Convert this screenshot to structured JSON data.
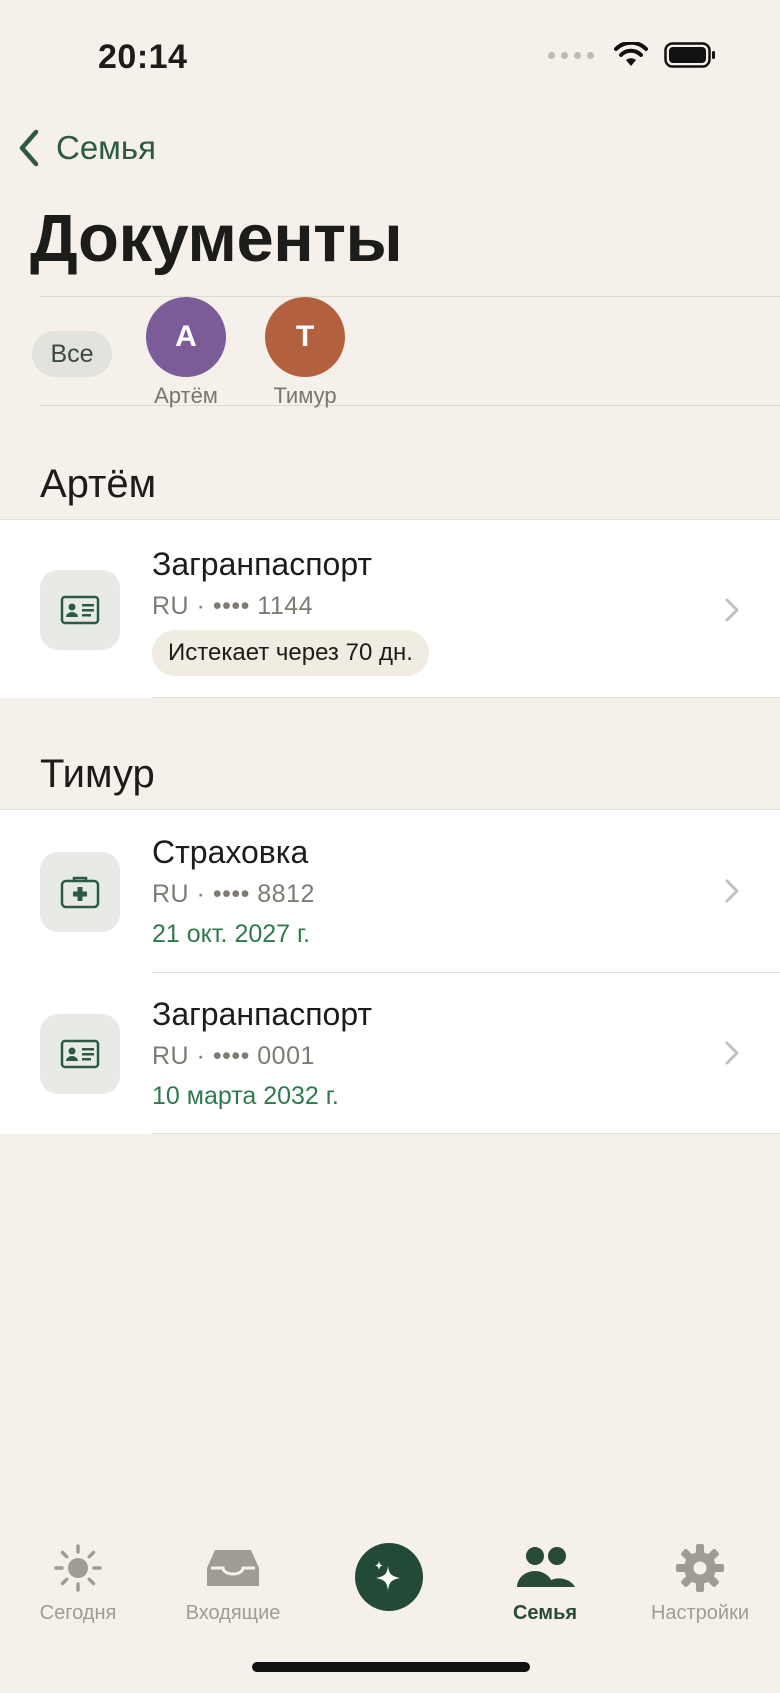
{
  "status_bar": {
    "time": "20:14"
  },
  "nav": {
    "back_label": "Семья"
  },
  "page": {
    "title": "Документы"
  },
  "filters": {
    "all_label": "Все",
    "people": [
      {
        "initial": "А",
        "name": "Артём",
        "color": "#7c5b99"
      },
      {
        "initial": "Т",
        "name": "Тимур",
        "color": "#b3603f"
      }
    ]
  },
  "sections": [
    {
      "header": "Артём",
      "items": [
        {
          "icon": "id-card-icon",
          "title": "Загранпаспорт",
          "subtitle": "RU · •••• 1144",
          "badge": "Истекает через 70 дн."
        }
      ]
    },
    {
      "header": "Тимур",
      "items": [
        {
          "icon": "medical-kit-icon",
          "title": "Страховка",
          "subtitle": "RU · •••• 8812",
          "date": "21 окт. 2027 г."
        },
        {
          "icon": "id-card-icon",
          "title": "Загранпаспорт",
          "subtitle": "RU · •••• 0001",
          "date": "10 марта 2032 г."
        }
      ]
    }
  ],
  "tab_bar": {
    "tabs": [
      {
        "label": "Сегодня",
        "icon": "sun-icon"
      },
      {
        "label": "Входящие",
        "icon": "inbox-icon"
      },
      {
        "label": "Семья",
        "icon": "people-icon",
        "active": true
      },
      {
        "label": "Настройки",
        "icon": "gear-icon"
      }
    ],
    "center_icon": "sparkles-icon"
  },
  "colors": {
    "accent": "#2d5a43",
    "background": "#f5f1ea",
    "date_green": "#2f7a4d"
  }
}
